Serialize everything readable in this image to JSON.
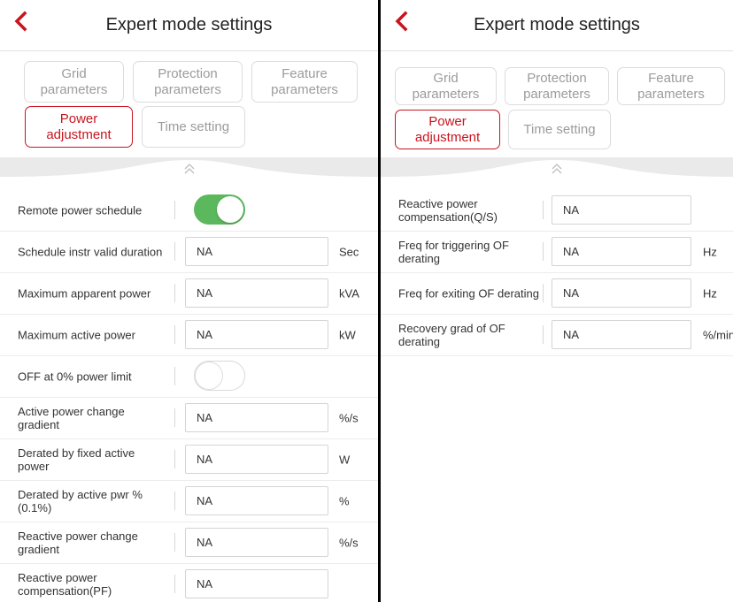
{
  "left": {
    "title": "Expert mode settings",
    "tabs": [
      {
        "label": "Grid parameters",
        "active": false
      },
      {
        "label": "Protection parameters",
        "active": false
      },
      {
        "label": "Feature parameters",
        "active": false
      },
      {
        "label": "Power adjustment",
        "active": true
      },
      {
        "label": "Time setting",
        "active": false
      }
    ],
    "rows": [
      {
        "label": "Remote power schedule",
        "type": "toggle",
        "state": "on"
      },
      {
        "label": "Schedule instr valid duration",
        "type": "input",
        "value": "NA",
        "unit": "Sec"
      },
      {
        "label": "Maximum apparent power",
        "type": "input",
        "value": "NA",
        "unit": "kVA"
      },
      {
        "label": "Maximum active power",
        "type": "input",
        "value": "NA",
        "unit": "kW"
      },
      {
        "label": "OFF at 0% power limit",
        "type": "toggle",
        "state": "off"
      },
      {
        "label": "Active power change gradient",
        "type": "input",
        "value": "NA",
        "unit": "%/s"
      },
      {
        "label": "Derated by fixed active power",
        "type": "input",
        "value": "NA",
        "unit": "W"
      },
      {
        "label": "Derated by active pwr % (0.1%)",
        "type": "input",
        "value": "NA",
        "unit": "%"
      },
      {
        "label": "Reactive power change gradient",
        "type": "input",
        "value": "NA",
        "unit": "%/s"
      },
      {
        "label": "Reactive power compensation(PF)",
        "type": "input",
        "value": "NA",
        "unit": ""
      }
    ]
  },
  "right": {
    "title": "Expert mode settings",
    "tabs": [
      {
        "label": "Grid parameters",
        "active": false
      },
      {
        "label": "Protection parameters",
        "active": false
      },
      {
        "label": "Feature parameters",
        "active": false
      },
      {
        "label": "Power adjustment",
        "active": true
      },
      {
        "label": "Time setting",
        "active": false
      }
    ],
    "rows": [
      {
        "label": "Reactive power compensation(Q/S)",
        "type": "input",
        "value": "NA",
        "unit": ""
      },
      {
        "label": "Freq for triggering OF derating",
        "type": "input",
        "value": "NA",
        "unit": "Hz"
      },
      {
        "label": "Freq for exiting OF derating",
        "type": "input",
        "value": "NA",
        "unit": "Hz"
      },
      {
        "label": "Recovery grad of OF derating",
        "type": "input",
        "value": "NA",
        "unit": "%/min"
      }
    ]
  },
  "colors": {
    "accent": "#c8141e",
    "toggle_on": "#5cb85c",
    "inactive_tab_text": "#9c9c9c"
  },
  "icons": {
    "back": "chevron-left-icon",
    "collapse": "double-chevron-up-icon"
  }
}
